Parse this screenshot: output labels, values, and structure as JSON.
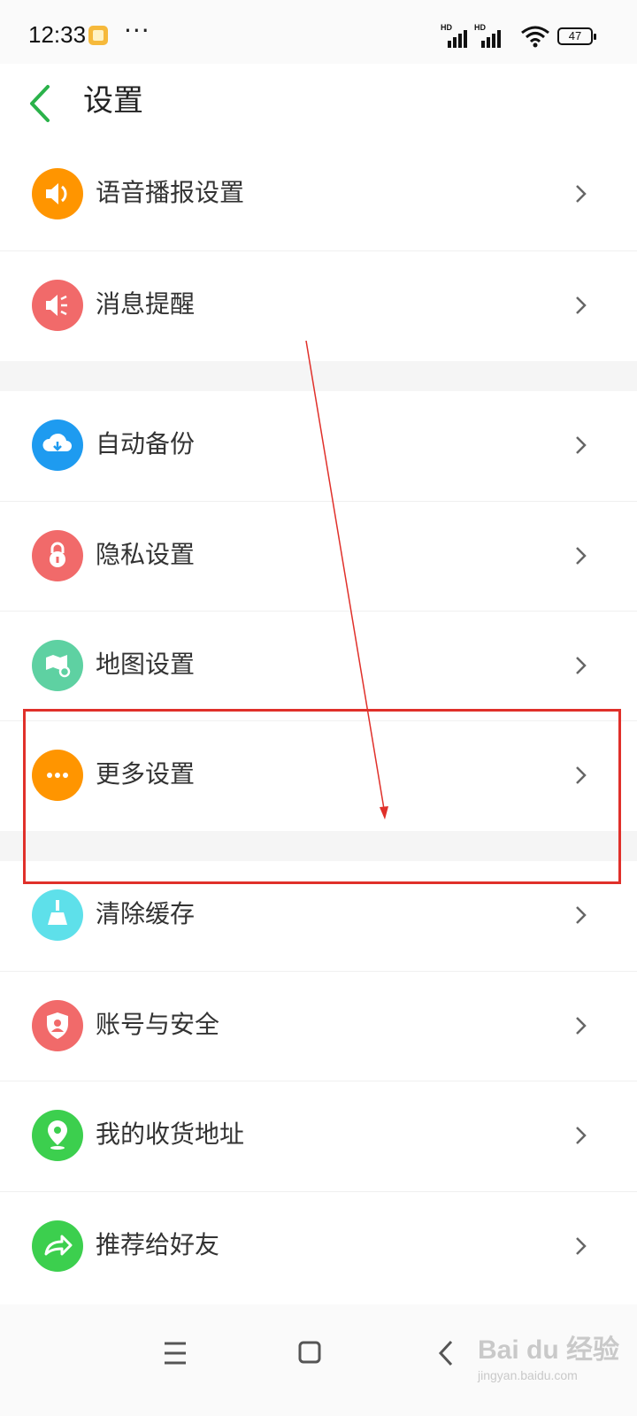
{
  "status_bar": {
    "time": "12:33",
    "more": "···",
    "signal1_label": "HD",
    "signal2_label": "HD",
    "battery": "47"
  },
  "header": {
    "title": "设置",
    "back_icon": "chevron-left-icon"
  },
  "settings": {
    "items": [
      {
        "label": "语音播报设置",
        "icon": "speaker-icon",
        "color": "#ff9500"
      },
      {
        "label": "消息提醒",
        "icon": "megaphone-icon",
        "color": "#f16a6a"
      },
      {
        "label": "自动备份",
        "icon": "cloud-download-icon",
        "color": "#1e9bf0"
      },
      {
        "label": "隐私设置",
        "icon": "lock-icon",
        "color": "#f16a6a"
      },
      {
        "label": "地图设置",
        "icon": "map-gear-icon",
        "color": "#5ed1a2"
      },
      {
        "label": "更多设置",
        "icon": "more-dots-icon",
        "color": "#ff9500"
      },
      {
        "label": "清除缓存",
        "icon": "broom-icon",
        "color": "#5ee0ea"
      },
      {
        "label": "账号与安全",
        "icon": "shield-user-icon",
        "color": "#f16a6a"
      },
      {
        "label": "我的收货地址",
        "icon": "location-pin-icon",
        "color": "#3ccf4e"
      },
      {
        "label": "推荐给好友",
        "icon": "share-arrow-icon",
        "color": "#3ccf4e"
      }
    ]
  },
  "annotation": {
    "highlight_color": "#e0302a"
  },
  "nav_bar": {
    "icons": [
      "menu-icon",
      "home-square-icon",
      "back-chevron-icon"
    ]
  },
  "watermark": {
    "logo": "Bai du 经验",
    "site": "jingyan.baidu.com"
  }
}
